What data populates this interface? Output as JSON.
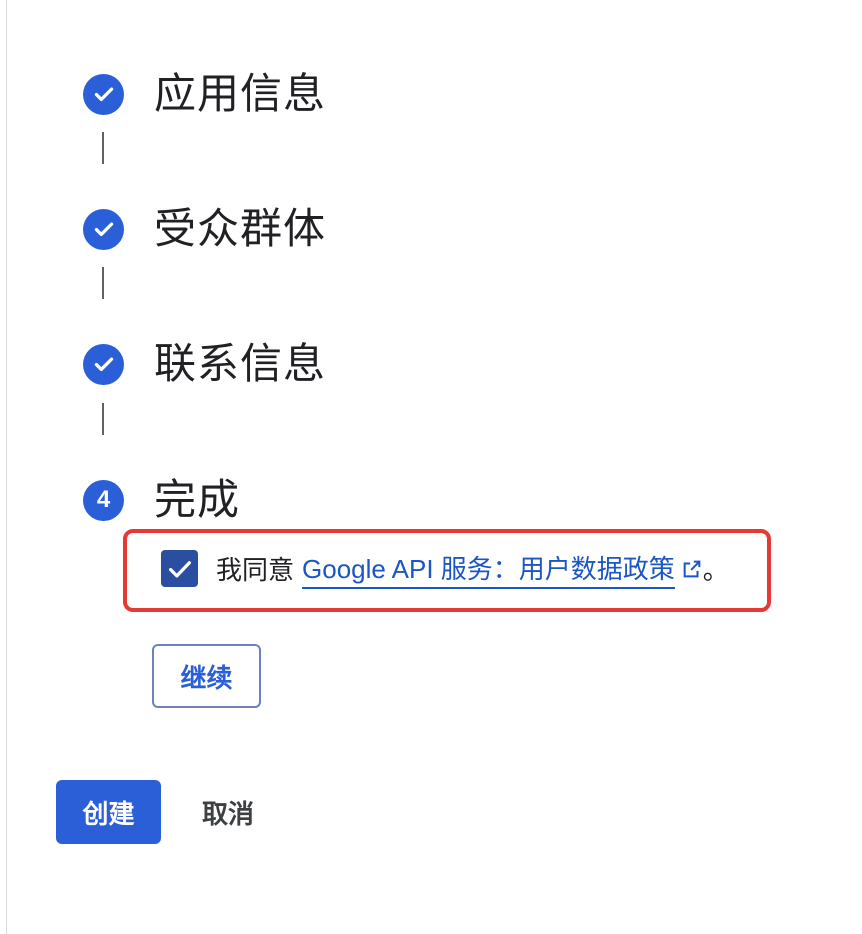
{
  "steps": [
    {
      "title": "应用信息",
      "status": "done",
      "icon": "check-icon"
    },
    {
      "title": "受众群体",
      "status": "done",
      "icon": "check-icon"
    },
    {
      "title": "联系信息",
      "status": "done",
      "icon": "check-icon"
    },
    {
      "title": "完成",
      "status": "current",
      "number": "4"
    }
  ],
  "agreement": {
    "checked": true,
    "prefix": "我同意",
    "link_text": "Google API 服务：用户数据政策",
    "suffix": "。",
    "link_icon": "open-in-new-icon"
  },
  "buttons": {
    "continue": "继续",
    "create": "创建",
    "cancel": "取消"
  },
  "colors": {
    "primary": "#2a5fd8",
    "checkbox": "#2a4fa0",
    "link": "#1a56c4",
    "highlight": "#e53935"
  }
}
